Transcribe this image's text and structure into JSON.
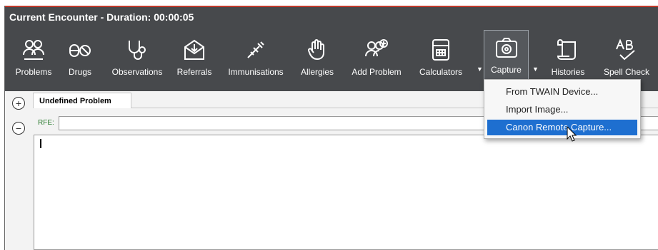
{
  "window": {
    "title": "Current Encounter - Duration: 00:00:05"
  },
  "toolbar": {
    "buttons": [
      {
        "label": "Problems",
        "icon": "people-icon"
      },
      {
        "label": "Drugs",
        "icon": "pills-icon"
      },
      {
        "label": "Observations",
        "icon": "stethoscope-icon"
      },
      {
        "label": "Referrals",
        "icon": "envelope-icon"
      },
      {
        "label": "Immunisations",
        "icon": "syringe-icon"
      },
      {
        "label": "Allergies",
        "icon": "hand-icon"
      },
      {
        "label": "Add Problem",
        "icon": "add-people-icon"
      },
      {
        "label": "Calculators",
        "icon": "calculator-icon"
      },
      {
        "label": "Capture",
        "icon": "camera-icon"
      },
      {
        "label": "Histories",
        "icon": "scroll-icon"
      },
      {
        "label": "Spell Check",
        "icon": "spellcheck-icon"
      }
    ]
  },
  "tabs": [
    {
      "label": "Undefined Problem"
    }
  ],
  "rfe": {
    "label": "RFE:",
    "value": ""
  },
  "capture_menu": {
    "items": [
      {
        "label": "From TWAIN Device..."
      },
      {
        "label": "Import Image..."
      },
      {
        "label": "Canon Remote Capture..."
      }
    ],
    "highlighted_index": 2
  },
  "colors": {
    "toolbar_bg": "#47494c",
    "highlight": "#1e6fd0",
    "rfe_label": "#2e7d32"
  }
}
